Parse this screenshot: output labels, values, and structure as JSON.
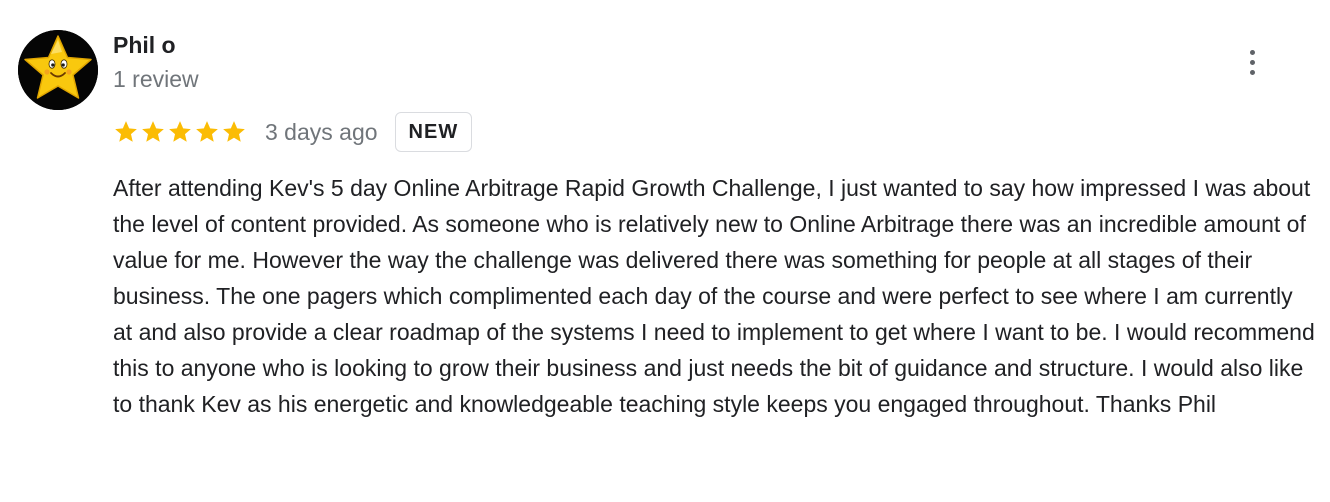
{
  "review": {
    "reviewer_name": "Phil o",
    "review_count": "1 review",
    "avatar_icon": "star-cartoon-icon",
    "more_icon": "more-vert-icon",
    "rating": 5,
    "rating_max": 5,
    "star_color": "#fbbc04",
    "date": "3 days ago",
    "badge": "NEW",
    "text": "After attending Kev's 5 day Online Arbitrage Rapid Growth Challenge, I just wanted to say how impressed I was about the level of content provided. As someone who is relatively new to Online Arbitrage there was an incredible amount of value for me. However the way the challenge was delivered there was something for people at all stages of their business. The one pagers which complimented each day of the course and were perfect to see where I am currently at and also provide a clear roadmap of the systems I need to implement to get where I want to be. I would recommend this to anyone who is looking to grow their business and just needs the bit of guidance and structure. I would also like to thank Kev as his energetic and knowledgeable teaching style keeps you engaged throughout. Thanks Phil"
  }
}
